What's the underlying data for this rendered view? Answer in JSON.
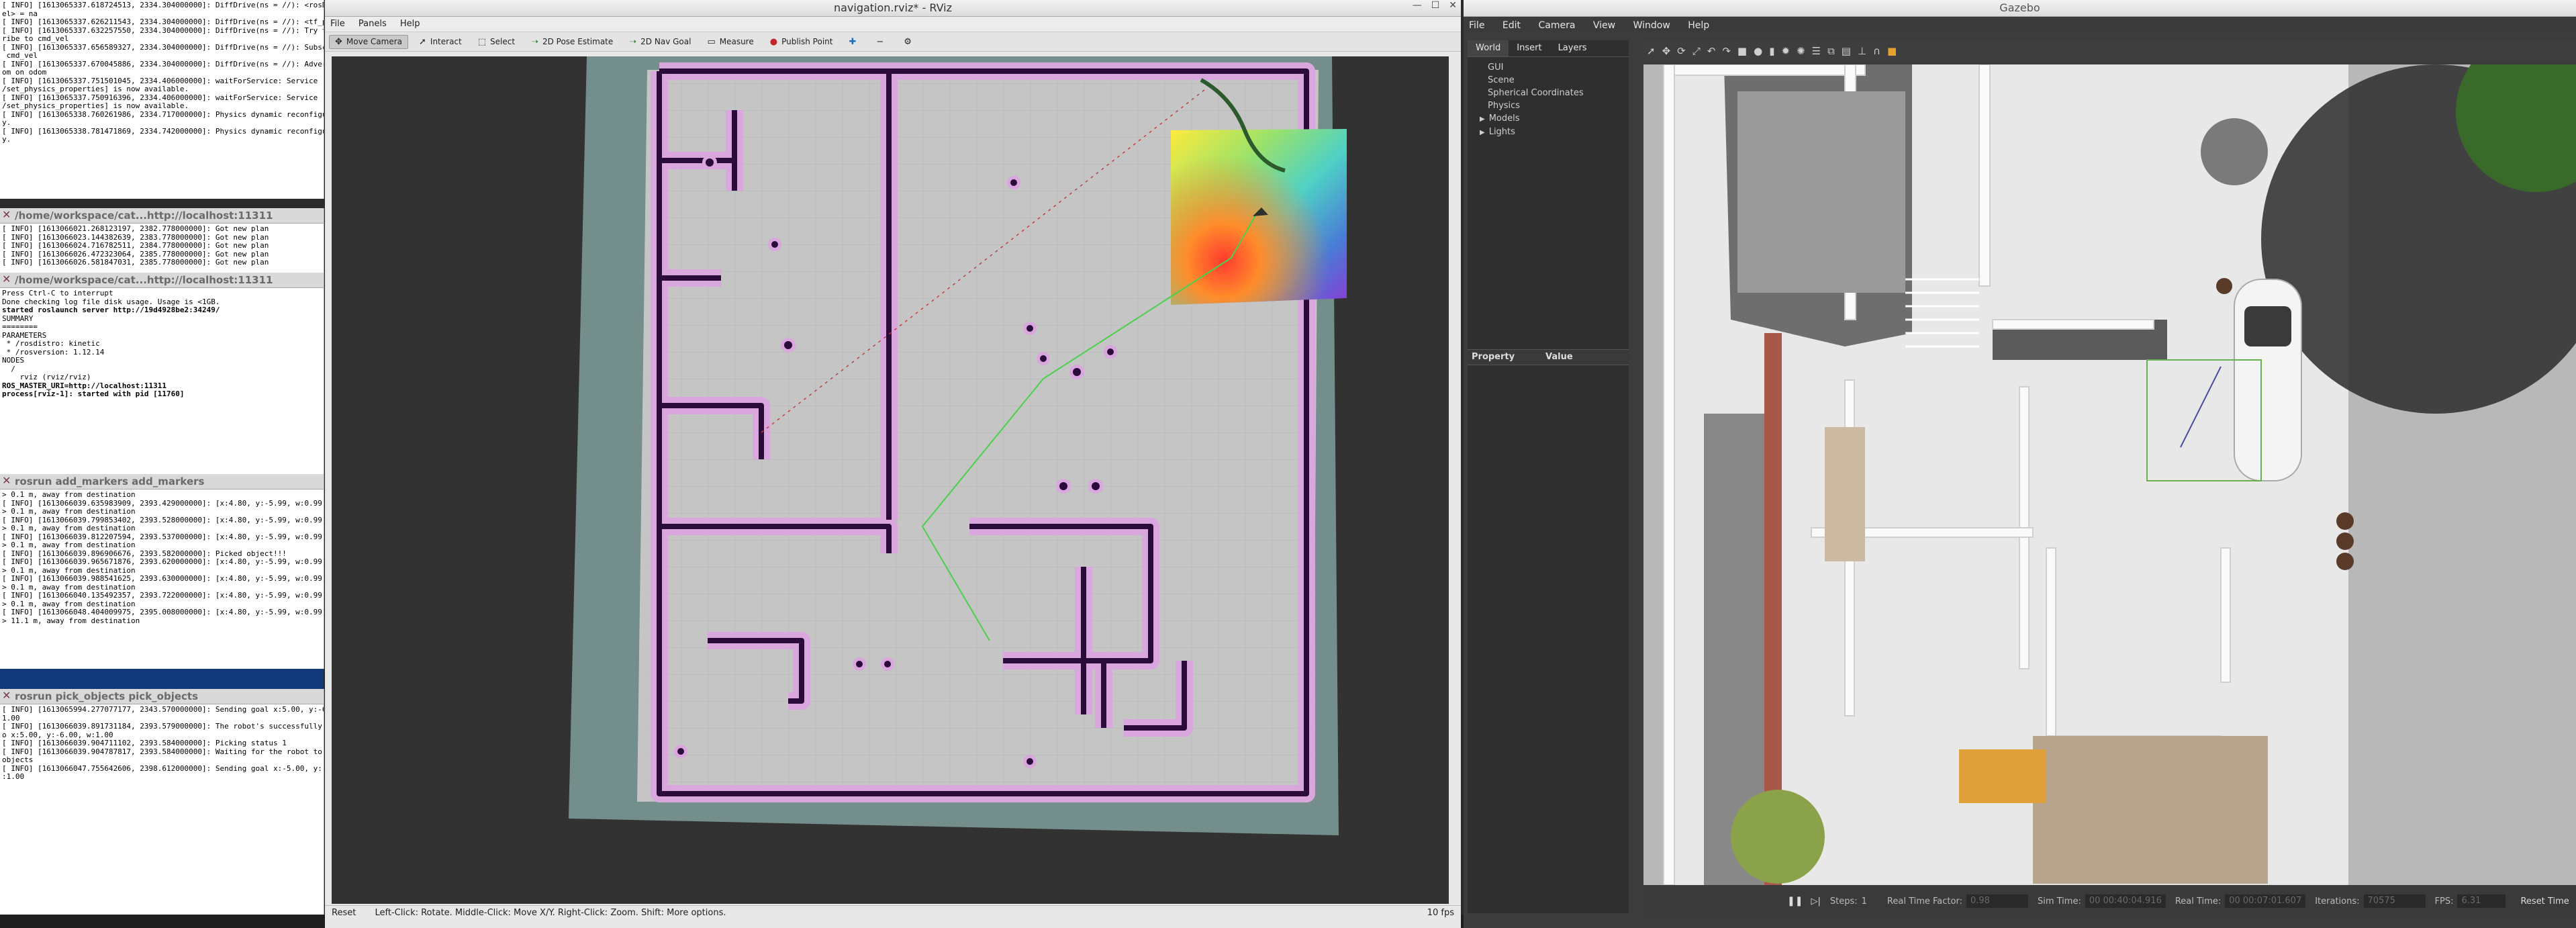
{
  "terminals": [
    {
      "title": "",
      "lines": [
        "[ INFO] [1613065337.618724513, 2334.304000000]: DiffDrive(ns = //): <rosDebugLev",
        "el> = na",
        "[ INFO] [1613065337.626211543, 2334.304000000]: DiffDrive(ns = //): <tf_prefix>",
        "",
        "[ INFO] [1613065337.632257550, 2334.304000000]: DiffDrive(ns = //): Try to subsc",
        "ribe to cmd_vel",
        "[ INFO] [1613065337.656589327, 2334.304000000]: DiffDrive(ns = //): Subscribe to",
        " cmd_vel",
        "[ INFO] [1613065337.670045886, 2334.304000000]: DiffDrive(ns = //): Advertise od",
        "om on odom",
        "[ INFO] [1613065337.751501045, 2334.406000000]: waitForService: Service [/gazebo",
        "/set_physics_properties] is now available.",
        "[ INFO] [1613065337.750916396, 2334.406000000]: waitForService: Service [/gazebo",
        "/set_physics_properties] is now available.",
        "[ INFO] [1613065338.760261986, 2334.717000000]: Physics dynamic reconfigure read",
        "y.",
        "[ INFO] [1613065338.781471869, 2334.742000000]: Physics dynamic reconfigure read",
        "y."
      ]
    },
    {
      "title": "/home/workspace/cat...http://localhost:11311",
      "lines": [
        "[ INFO] [1613066021.268123197, 2382.778000000]: Got new plan",
        "[ INFO] [1613066023.144382639, 2383.778000000]: Got new plan",
        "[ INFO] [1613066024.716782511, 2384.778000000]: Got new plan",
        "[ INFO] [1613066026.472323064, 2385.778000000]: Got new plan",
        "[ INFO] [1613066026.581847031, 2385.778000000]: Got new plan"
      ]
    },
    {
      "title": "/home/workspace/cat...http://localhost:11311",
      "lines": [
        "Press Ctrl-C to interrupt",
        "Done checking log file disk usage. Usage is <1GB.",
        "",
        "started roslaunch server http://19d4928be2:34249/",
        "",
        "SUMMARY",
        "========",
        "",
        "PARAMETERS",
        " * /rosdistro: kinetic",
        " * /rosversion: 1.12.14",
        "",
        "NODES",
        "  /",
        "    rviz (rviz/rviz)",
        "",
        "ROS_MASTER_URI=http://localhost:11311",
        "",
        "process[rviz-1]: started with pid [11760]"
      ]
    },
    {
      "title": "rosrun add_markers add_markers",
      "lines": [
        "> 0.1 m, away from destination",
        "[ INFO] [1613066039.635983909, 2393.429000000]: [x:4.80, y:-5.99, w:0.99] Robot'",
        "> 0.1 m, away from destination",
        "[ INFO] [1613066039.799853402, 2393.528000000]: [x:4.80, y:-5.99, w:0.99] Robot'",
        "> 0.1 m, away from destination",
        "[ INFO] [1613066039.812207594, 2393.537000000]: [x:4.80, y:-5.99, w:0.99] Robot'",
        "> 0.1 m, away from destination",
        "[ INFO] [1613066039.896906676, 2393.582000000]: Picked object!!!",
        "",
        "",
        "[ INFO] [1613066039.965671876, 2393.620000000]: [x:4.80, y:-5.99, w:0.99] Robot'",
        "> 0.1 m, away from destination",
        "[ INFO] [1613066039.988541625, 2393.630000000]: [x:4.80, y:-5.99, w:0.99] Robot'",
        "> 0.1 m, away from destination",
        "[ INFO] [1613066040.135492357, 2393.722000000]: [x:4.80, y:-5.99, w:0.99] Robot'",
        "> 0.1 m, away from destination",
        "[ INFO] [1613066048.404009975, 2395.008000000]: [x:4.80, y:-5.99, w:0.99] Robot'",
        "> 11.1 m, away from destination"
      ]
    },
    {
      "title": "rosrun pick_objects pick_objects",
      "lines": [
        "[ INFO] [1613065994.277077177, 2343.570000000]: Sending goal x:5.00, y:-6.00, w:",
        "1.00",
        "[ INFO] [1613066039.891731184, 2393.579000000]: The robot's successfully moved t",
        "o x:5.00, y:-6.00, w:1.00",
        "[ INFO] [1613066039.904711102, 2393.584000000]: Picking status 1",
        "[ INFO] [1613066039.904787817, 2393.584000000]: Waiting for the robot to pickup",
        "objects",
        "[ INFO] [1613066047.755642606, 2398.612000000]: Sending goal x:-5.00, y:-2.00, w",
        ":1.00"
      ]
    }
  ],
  "rviz": {
    "title": "navigation.rviz* - RViz",
    "menu": [
      "File",
      "Panels",
      "Help"
    ],
    "tools": [
      "Move Camera",
      "Interact",
      "Select",
      "2D Pose Estimate",
      "2D Nav Goal",
      "Measure",
      "Publish Point"
    ],
    "status_reset": "Reset",
    "status_hint": "Left-Click: Rotate. Middle-Click: Move X/Y. Right-Click: Zoom. Shift: More options.",
    "fps": "10 fps"
  },
  "gazebo": {
    "title": "Gazebo",
    "menu": [
      "File",
      "Edit",
      "Camera",
      "View",
      "Window",
      "Help"
    ],
    "tabs": [
      "World",
      "Insert",
      "Layers"
    ],
    "tree": [
      "GUI",
      "Scene",
      "Spherical Coordinates",
      "Physics",
      "Models",
      "Lights"
    ],
    "prop_headers": [
      "Property",
      "Value"
    ],
    "steps_label": "Steps:",
    "steps_value": "1",
    "rtf_label": "Real Time Factor:",
    "rtf_value": "0.98",
    "sim_time_label": "Sim Time:",
    "sim_time_value": "00 00:40:04.916",
    "real_time_label": "Real Time:",
    "real_time_value": "00 00:07:01.607",
    "iterations_label": "Iterations:",
    "iterations_value": "70575",
    "fps_label": "FPS:",
    "fps_value": "6.31",
    "reset_time": "Reset Time"
  },
  "colors": {
    "costmap_free": "#c4c4c4",
    "costmap_unknown": "#738c8c",
    "wall": "#2a0b3a",
    "inflation": "#d7a3dc",
    "gz_floor": "#b7b7b7"
  }
}
